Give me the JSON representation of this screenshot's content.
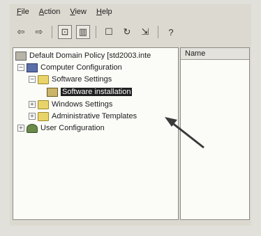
{
  "menu": [
    "File",
    "Action",
    "View",
    "Help"
  ],
  "toolbar": [
    "back-icon",
    "forward-icon",
    "up-folder-icon",
    "show-hide-tree-icon",
    "properties-icon",
    "refresh-icon",
    "export-list-icon",
    "help-icon"
  ],
  "tree": {
    "root": "Default Domain Policy [std2003.inte",
    "computer": "Computer Configuration",
    "software_settings": "Software Settings",
    "software_installation": "Software installation",
    "windows_settings": "Windows Settings",
    "admin_templates": "Administrative Templates",
    "user": "User Configuration"
  },
  "right_pane": {
    "column": "Name"
  },
  "colors": {
    "selection": "#1f1f1f",
    "pane_bg": "#fbfbf8"
  }
}
